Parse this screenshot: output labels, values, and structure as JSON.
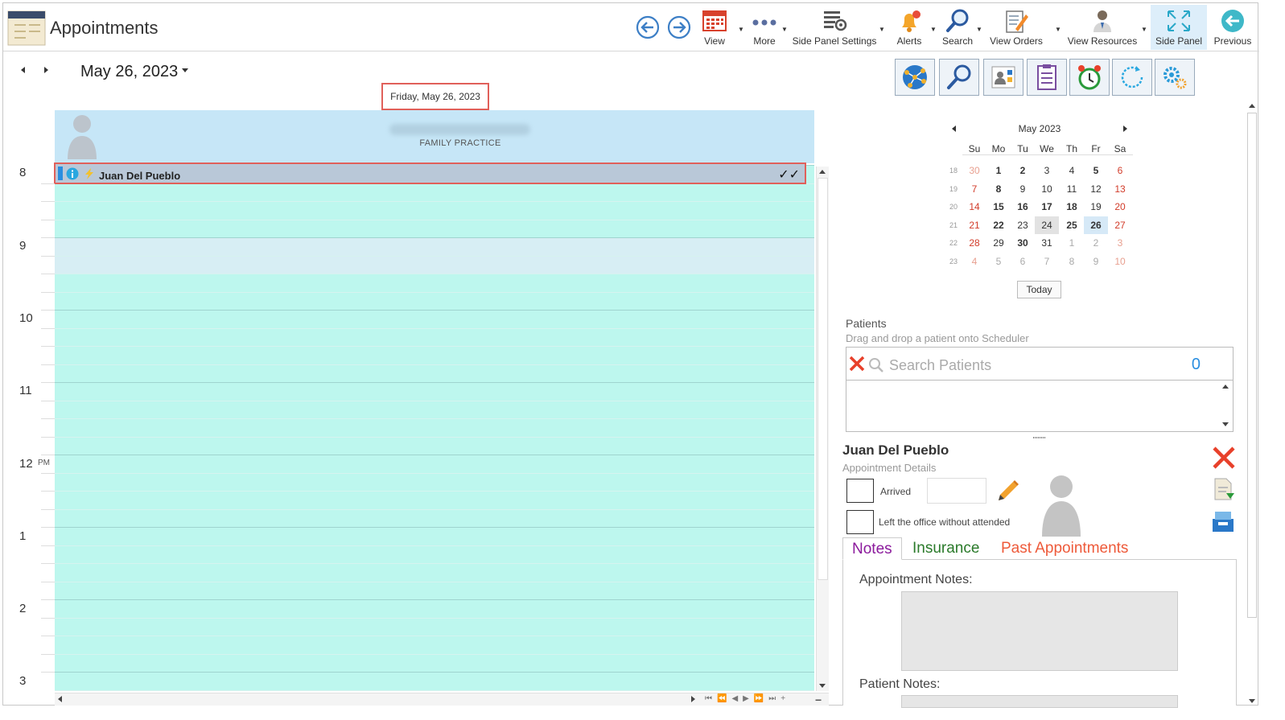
{
  "app": {
    "title": "Appointments"
  },
  "toolbar": {
    "back_label": "back",
    "forward_label": "forward",
    "view": "View",
    "more": "More",
    "side_panel_settings": "Side Panel Settings",
    "alerts": "Alerts",
    "search": "Search",
    "view_orders": "View Orders",
    "view_resources": "View Resources",
    "side_panel": "Side Panel",
    "previous": "Previous"
  },
  "date_nav": {
    "current_date": "May 26, 2023"
  },
  "day_view": {
    "day_header": "Friday, May 26, 2023",
    "resource_dept": "FAMILY PRACTICE",
    "hours": [
      "8",
      "9",
      "10",
      "11",
      "12",
      "1",
      "2",
      "3"
    ],
    "pm_suffix": "PM",
    "appointment": {
      "patient_name": "Juan Del Pueblo",
      "status": "✓✓"
    }
  },
  "calendar": {
    "title": "May 2023",
    "weekdays": [
      "Su",
      "Mo",
      "Tu",
      "We",
      "Th",
      "Fr",
      "Sa"
    ],
    "weeks": [
      {
        "num": "18",
        "days": [
          "30",
          "1",
          "2",
          "3",
          "4",
          "5",
          "6"
        ]
      },
      {
        "num": "19",
        "days": [
          "7",
          "8",
          "9",
          "10",
          "11",
          "12",
          "13"
        ]
      },
      {
        "num": "20",
        "days": [
          "14",
          "15",
          "16",
          "17",
          "18",
          "19",
          "20"
        ]
      },
      {
        "num": "21",
        "days": [
          "21",
          "22",
          "23",
          "24",
          "25",
          "26",
          "27"
        ]
      },
      {
        "num": "22",
        "days": [
          "28",
          "29",
          "30",
          "31",
          "1",
          "2",
          "3"
        ]
      },
      {
        "num": "23",
        "days": [
          "4",
          "5",
          "6",
          "7",
          "8",
          "9",
          "10"
        ]
      }
    ],
    "today_label": "Today",
    "colors": {
      "weekend": "#d23c2a",
      "other_month": "#e8a090",
      "bold": "#222"
    }
  },
  "patients": {
    "label": "Patients",
    "hint": "Drag and drop a patient onto Scheduler",
    "search_placeholder": "Search Patients",
    "count": "0"
  },
  "details": {
    "patient_name": "Juan Del Pueblo",
    "subtitle": "Appointment Details",
    "arrived_label": "Arrived",
    "left_label": "Left the office without attended",
    "tabs": [
      {
        "label": "Notes",
        "color": "#8b1a9c"
      },
      {
        "label": "Insurance",
        "color": "#2a7a2a"
      },
      {
        "label": "Past Appointments",
        "color": "#ee5a3a"
      }
    ],
    "appointment_notes_label": "Appointment Notes:",
    "patient_notes_label": "Patient Notes:"
  }
}
